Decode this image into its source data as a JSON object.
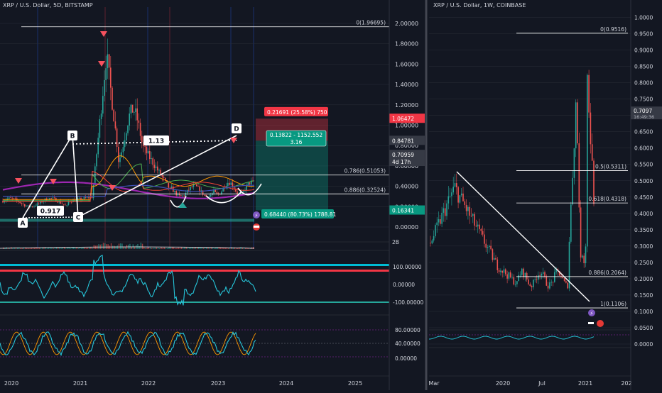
{
  "left_chart": {
    "title": "XRP / U.S. Dollar, 5D, BITSTAMP",
    "price_ticks": [
      "2.00000",
      "1.80000",
      "1.60000",
      "1.40000",
      "1.20000",
      "1.00000",
      "0.80000",
      "0.60000",
      "0.40000",
      "0.20000",
      "0.00000"
    ],
    "price_tick_values": [
      2.0,
      1.8,
      1.6,
      1.4,
      1.2,
      1.0,
      0.8,
      0.6,
      0.4,
      0.2,
      0.0
    ],
    "time_ticks": [
      "2020",
      "2021",
      "2022",
      "2023",
      "2024",
      "2025"
    ],
    "fib_levels": [
      {
        "label": "0(1.96695)",
        "value": 1.96695
      },
      {
        "label": "0.786(0.51053)",
        "value": 0.51053
      },
      {
        "label": "0.886(0.32524)",
        "value": 0.32524
      }
    ],
    "price_badges": [
      {
        "text": "1.06472",
        "value": 1.06472,
        "color": "#f23645"
      },
      {
        "text": "0.84781",
        "value": 0.84781,
        "color": "#363a45"
      },
      {
        "text": "0.70959",
        "value": 0.70959,
        "color": "#363a45"
      },
      {
        "text": "4d 17h",
        "value": 0.63,
        "color": "#363a45"
      },
      {
        "text": "0.16341",
        "value": 0.16341,
        "color": "#089981"
      }
    ],
    "position_boxes": {
      "target_label": "0.21691 (25.58%) 750",
      "profit_label_line1": "0.13822 - 1152.552",
      "profit_label_line2": "3.16",
      "stop_label": "0.68440 (80.73%) 1788.81"
    },
    "pattern_points": [
      "A",
      "B",
      "C",
      "D"
    ],
    "pattern_ratios": [
      "0.917",
      "1.13"
    ],
    "osc1_ticks": [
      "100.00000",
      "0.00000",
      "-100.00000"
    ],
    "osc2_ticks": [
      "80.00000",
      "40.00000",
      "0.00000"
    ],
    "volume_tick": "2B",
    "colors": {
      "up": "#26a69a",
      "down": "#ef5350",
      "ma_purple": "#9c27b0",
      "fib": "#ffffff",
      "osc_line": "#2196f3",
      "osc_band_red": "#f23645",
      "osc_band_blue": "#00bcd4",
      "osc_band_green": "#26a69a"
    }
  },
  "right_chart": {
    "title": "XRP / U.S. Dollar, 1W, COINBASE",
    "price_ticks": [
      "1.0000",
      "0.9500",
      "0.9000",
      "0.8500",
      "0.8000",
      "0.7500",
      "0.7000",
      "0.6500",
      "0.6000",
      "0.5500",
      "0.5000",
      "0.4500",
      "0.4000",
      "0.3500",
      "0.3000",
      "0.2500",
      "0.2000",
      "0.1500",
      "0.1000",
      "0.0500",
      "0.0000"
    ],
    "price_tick_values": [
      1.0,
      0.95,
      0.9,
      0.85,
      0.8,
      0.75,
      0.7,
      0.65,
      0.6,
      0.55,
      0.5,
      0.45,
      0.4,
      0.35,
      0.3,
      0.25,
      0.2,
      0.15,
      0.1,
      0.05,
      0.0
    ],
    "time_ticks": [
      "Mar",
      "2020",
      "Jul",
      "2021",
      "202"
    ],
    "fib_levels": [
      {
        "label": "0(0.9516)",
        "value": 0.9516
      },
      {
        "label": "0.5(0.5311)",
        "value": 0.5311
      },
      {
        "label": "0.618(0.4318)",
        "value": 0.4318
      },
      {
        "label": "0.886(0.2064)",
        "value": 0.2064
      },
      {
        "label": "1(0.1106)",
        "value": 0.1106
      }
    ],
    "price_badge": {
      "text": "0.7097",
      "value": 0.7097
    },
    "countdown": "16:49:36"
  }
}
